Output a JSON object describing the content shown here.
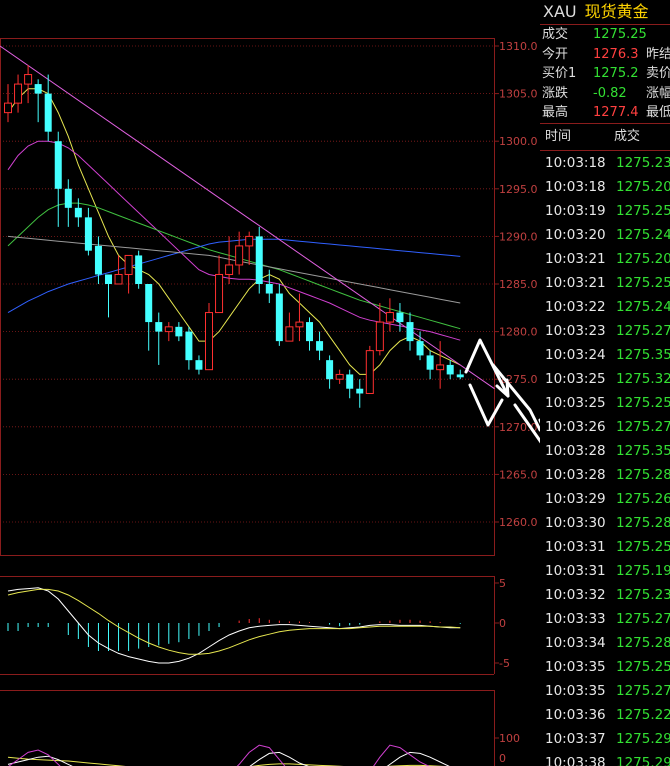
{
  "instrument": {
    "symbol": "XAU",
    "name": "现货黄金"
  },
  "quote": [
    {
      "label": "成交",
      "value": "1275.25",
      "color": "#33e033",
      "label2": ""
    },
    {
      "label": "今开",
      "value": "1276.3",
      "color": "#ff4040",
      "label2": "昨结"
    },
    {
      "label": "买价1",
      "value": "1275.2",
      "color": "#33e033",
      "label2": "卖价"
    },
    {
      "label": "涨跌",
      "value": "-0.82",
      "color": "#33e033",
      "label2": "涨幅"
    },
    {
      "label": "最高",
      "value": "1277.4",
      "color": "#ff4040",
      "label2": "最低"
    }
  ],
  "ticks_header": {
    "time": "时间",
    "price": "成交"
  },
  "ticks": [
    {
      "time": "10:03:18",
      "price": "1275.23",
      "color": "#33e033"
    },
    {
      "time": "10:03:18",
      "price": "1275.20",
      "color": "#33e033"
    },
    {
      "time": "10:03:19",
      "price": "1275.25",
      "color": "#33e033"
    },
    {
      "time": "10:03:20",
      "price": "1275.24",
      "color": "#33e033"
    },
    {
      "time": "10:03:21",
      "price": "1275.20",
      "color": "#33e033"
    },
    {
      "time": "10:03:21",
      "price": "1275.25",
      "color": "#33e033"
    },
    {
      "time": "10:03:22",
      "price": "1275.24",
      "color": "#33e033"
    },
    {
      "time": "10:03:23",
      "price": "1275.27",
      "color": "#33e033"
    },
    {
      "time": "10:03:24",
      "price": "1275.35",
      "color": "#33e033"
    },
    {
      "time": "10:03:25",
      "price": "1275.32",
      "color": "#33e033"
    },
    {
      "time": "10:03:25",
      "price": "1275.25",
      "color": "#33e033"
    },
    {
      "time": "10:03:26",
      "price": "1275.27",
      "color": "#33e033"
    },
    {
      "time": "10:03:28",
      "price": "1275.35",
      "color": "#33e033"
    },
    {
      "time": "10:03:28",
      "price": "1275.28",
      "color": "#33e033"
    },
    {
      "time": "10:03:29",
      "price": "1275.26",
      "color": "#33e033"
    },
    {
      "time": "10:03:30",
      "price": "1275.28",
      "color": "#33e033"
    },
    {
      "time": "10:03:31",
      "price": "1275.25",
      "color": "#33e033"
    },
    {
      "time": "10:03:31",
      "price": "1275.19",
      "color": "#33e033"
    },
    {
      "time": "10:03:32",
      "price": "1275.23",
      "color": "#33e033"
    },
    {
      "time": "10:03:33",
      "price": "1275.27",
      "color": "#33e033"
    },
    {
      "time": "10:03:34",
      "price": "1275.28",
      "color": "#33e033"
    },
    {
      "time": "10:03:35",
      "price": "1275.25",
      "color": "#33e033"
    },
    {
      "time": "10:03:35",
      "price": "1275.27",
      "color": "#33e033"
    },
    {
      "time": "10:03:36",
      "price": "1275.22",
      "color": "#33e033"
    },
    {
      "time": "10:03:37",
      "price": "1275.29",
      "color": "#33e033"
    },
    {
      "time": "10:03:38",
      "price": "1275.29",
      "color": "#33e033"
    }
  ],
  "chart_data": {
    "type": "candlestick",
    "price_axis": {
      "ticks": [
        "1310.0",
        "1305.0",
        "1300.0",
        "1295.0",
        "1290.0",
        "1285.0",
        "1280.0",
        "1275.0",
        "1270.0",
        "1265.0",
        "1260.0"
      ],
      "range": [
        1256,
        1313
      ]
    },
    "candles": [
      {
        "o": 1303,
        "h": 1306,
        "c": 1304,
        "l": 1302
      },
      {
        "o": 1304,
        "h": 1307,
        "c": 1306,
        "l": 1303
      },
      {
        "o": 1306,
        "h": 1308,
        "c": 1307,
        "l": 1304
      },
      {
        "o": 1306,
        "h": 1306.5,
        "c": 1305,
        "l": 1302
      },
      {
        "o": 1305,
        "h": 1307,
        "c": 1301,
        "l": 1300
      },
      {
        "o": 1300,
        "h": 1301,
        "c": 1295,
        "l": 1291
      },
      {
        "o": 1295,
        "h": 1296,
        "c": 1293,
        "l": 1291
      },
      {
        "o": 1293,
        "h": 1294,
        "c": 1292,
        "l": 1291
      },
      {
        "o": 1292,
        "h": 1293,
        "c": 1288.5,
        "l": 1288
      },
      {
        "o": 1289,
        "h": 1290,
        "c": 1286,
        "l": 1285
      },
      {
        "o": 1286,
        "h": 1286,
        "c": 1285,
        "l": 1281.5
      },
      {
        "o": 1285,
        "h": 1288,
        "c": 1286,
        "l": 1285
      },
      {
        "o": 1286,
        "h": 1288,
        "c": 1288,
        "l": 1284
      },
      {
        "o": 1288,
        "h": 1288.5,
        "c": 1285,
        "l": 1284.5
      },
      {
        "o": 1285,
        "h": 1285,
        "c": 1281,
        "l": 1278
      },
      {
        "o": 1281,
        "h": 1282,
        "c": 1280,
        "l": 1276.5
      },
      {
        "o": 1280,
        "h": 1281,
        "c": 1280.5,
        "l": 1279
      },
      {
        "o": 1280.5,
        "h": 1281,
        "c": 1279.5,
        "l": 1279
      },
      {
        "o": 1280,
        "h": 1280.5,
        "c": 1277,
        "l": 1276
      },
      {
        "o": 1277,
        "h": 1277.5,
        "c": 1276,
        "l": 1275.5
      },
      {
        "o": 1276,
        "h": 1283,
        "c": 1282,
        "l": 1276
      },
      {
        "o": 1282,
        "h": 1288,
        "c": 1286,
        "l": 1282
      },
      {
        "o": 1286,
        "h": 1290,
        "c": 1287,
        "l": 1285
      },
      {
        "o": 1287,
        "h": 1290.5,
        "c": 1289,
        "l": 1286
      },
      {
        "o": 1289,
        "h": 1290.5,
        "c": 1290,
        "l": 1287
      },
      {
        "o": 1290,
        "h": 1291,
        "c": 1285,
        "l": 1284
      },
      {
        "o": 1285,
        "h": 1286.5,
        "c": 1284,
        "l": 1283
      },
      {
        "o": 1284,
        "h": 1285,
        "c": 1279,
        "l": 1278.5
      },
      {
        "o": 1279,
        "h": 1282,
        "c": 1280.5,
        "l": 1279
      },
      {
        "o": 1280.5,
        "h": 1284,
        "c": 1281,
        "l": 1279
      },
      {
        "o": 1281,
        "h": 1281.5,
        "c": 1279,
        "l": 1278
      },
      {
        "o": 1279,
        "h": 1280,
        "c": 1278,
        "l": 1277
      },
      {
        "o": 1277,
        "h": 1277.5,
        "c": 1275,
        "l": 1274
      },
      {
        "o": 1275,
        "h": 1276,
        "c": 1275.5,
        "l": 1274.5
      },
      {
        "o": 1275.5,
        "h": 1276,
        "c": 1274,
        "l": 1273
      },
      {
        "o": 1274,
        "h": 1275,
        "c": 1273.5,
        "l": 1272
      },
      {
        "o": 1273.5,
        "h": 1278.5,
        "c": 1278,
        "l": 1273.5
      },
      {
        "o": 1278,
        "h": 1283,
        "c": 1281,
        "l": 1277.5
      },
      {
        "o": 1281,
        "h": 1283.5,
        "c": 1282,
        "l": 1280
      },
      {
        "o": 1282,
        "h": 1283,
        "c": 1281,
        "l": 1280
      },
      {
        "o": 1281,
        "h": 1282,
        "c": 1279,
        "l": 1278
      },
      {
        "o": 1279,
        "h": 1280,
        "c": 1277.5,
        "l": 1277
      },
      {
        "o": 1277.5,
        "h": 1278,
        "c": 1276,
        "l": 1275
      },
      {
        "o": 1276,
        "h": 1279,
        "c": 1276.5,
        "l": 1274
      },
      {
        "o": 1276.5,
        "h": 1277,
        "c": 1275.5,
        "l": 1275
      },
      {
        "o": 1275.5,
        "h": 1276,
        "c": 1275.2,
        "l": 1275
      }
    ],
    "ma": [
      {
        "name": "MA-yellow",
        "color": "#e6e650",
        "values": [
          1303,
          1304.5,
          1305.5,
          1305.5,
          1305,
          1303,
          1300.5,
          1297.5,
          1295,
          1292.5,
          1290,
          1288,
          1287,
          1286.5,
          1286,
          1285,
          1283.5,
          1282,
          1280.5,
          1279,
          1279,
          1280,
          1281.5,
          1283,
          1284.5,
          1285.5,
          1286,
          1285.5,
          1284,
          1283,
          1282,
          1281,
          1279.5,
          1278,
          1276.5,
          1275.5,
          1275.5,
          1276.5,
          1278,
          1279,
          1279.5,
          1279,
          1278,
          1277.5,
          1277,
          1276.5
        ]
      },
      {
        "name": "MA-magenta",
        "color": "#d040d0",
        "values": [
          1297,
          1298.5,
          1299.5,
          1300,
          1300,
          1299.8,
          1299.3,
          1298.5,
          1297.5,
          1296.5,
          1295.5,
          1294.5,
          1293.5,
          1292.5,
          1291.5,
          1290.5,
          1289.5,
          1288.5,
          1287.5,
          1286.5,
          1286,
          1285.8,
          1285.6,
          1285.5,
          1285.5,
          1285.4,
          1285.2,
          1285,
          1284.6,
          1284.2,
          1283.8,
          1283.4,
          1283,
          1282.5,
          1282,
          1281.5,
          1281.2,
          1281,
          1280.8,
          1280.6,
          1280.4,
          1280.2,
          1280,
          1279.7,
          1279.4,
          1279.1
        ]
      },
      {
        "name": "MA-green",
        "color": "#40c040",
        "values": [
          1289,
          1290,
          1291,
          1292,
          1292.8,
          1293.3,
          1293.5,
          1293.5,
          1293.3,
          1293,
          1292.6,
          1292.2,
          1291.8,
          1291.4,
          1291,
          1290.6,
          1290.2,
          1289.8,
          1289.4,
          1289,
          1288.6,
          1288.3,
          1288,
          1287.7,
          1287.4,
          1287.1,
          1286.8,
          1286.5,
          1286.1,
          1285.7,
          1285.3,
          1284.9,
          1284.5,
          1284.1,
          1283.7,
          1283.3,
          1283,
          1282.7,
          1282.4,
          1282.1,
          1281.8,
          1281.5,
          1281.2,
          1280.9,
          1280.6,
          1280.3
        ]
      },
      {
        "name": "MA-blue",
        "color": "#3060ff",
        "values": [
          1282,
          1282.6,
          1283.2,
          1283.7,
          1284.2,
          1284.6,
          1285,
          1285.3,
          1285.6,
          1285.9,
          1286.2,
          1286.5,
          1286.8,
          1287.1,
          1287.4,
          1287.7,
          1288,
          1288.3,
          1288.6,
          1288.9,
          1289.2,
          1289.4,
          1289.5,
          1289.6,
          1289.7,
          1289.7,
          1289.7,
          1289.7,
          1289.6,
          1289.5,
          1289.4,
          1289.3,
          1289.2,
          1289.1,
          1289,
          1288.9,
          1288.8,
          1288.7,
          1288.6,
          1288.5,
          1288.4,
          1288.3,
          1288.2,
          1288.1,
          1288,
          1287.9
        ]
      },
      {
        "name": "MA-grey",
        "color": "#9a9a9a",
        "values": [
          1290,
          1289.9,
          1289.8,
          1289.7,
          1289.6,
          1289.5,
          1289.4,
          1289.3,
          1289.2,
          1289.1,
          1289,
          1288.9,
          1288.8,
          1288.7,
          1288.6,
          1288.5,
          1288.4,
          1288.3,
          1288.2,
          1288.1,
          1288,
          1287.8,
          1287.6,
          1287.4,
          1287.2,
          1287,
          1286.8,
          1286.6,
          1286.4,
          1286.2,
          1286,
          1285.8,
          1285.6,
          1285.4,
          1285.2,
          1285,
          1284.8,
          1284.6,
          1284.4,
          1284.2,
          1284,
          1283.8,
          1283.6,
          1283.4,
          1283.2,
          1283
        ]
      }
    ],
    "trendline": {
      "color": "#e060e0",
      "from": [
        0,
        1310
      ],
      "to": [
        50,
        1274
      ]
    },
    "macd_axis": {
      "ticks": [
        "5",
        "0",
        "-5"
      ]
    },
    "macd": {
      "hist": [
        -1,
        -1,
        -0.5,
        -0.5,
        -0.5,
        0,
        -1.5,
        -2,
        -3,
        -3.5,
        -3.5,
        -3.5,
        -3.5,
        -3.2,
        -3,
        -2.8,
        -2.6,
        -2.4,
        -2,
        -1.6,
        -1,
        -0.5,
        0,
        0.3,
        0.5,
        0.6,
        0.4,
        0.3,
        0.2,
        0.2,
        0.1,
        0,
        -0.2,
        -0.4,
        -0.3,
        -0.2,
        0,
        0.2,
        0.3,
        0.4,
        0.4,
        0.3,
        0.2,
        0.1,
        0,
        -0.1
      ],
      "dif": [
        4,
        4.2,
        4.3,
        4.4,
        4,
        3,
        1.5,
        0,
        -1.5,
        -2.5,
        -3.2,
        -3.8,
        -4.2,
        -4.5,
        -4.8,
        -5,
        -5,
        -4.8,
        -4.4,
        -3.8,
        -3,
        -2.2,
        -1.5,
        -1,
        -0.6,
        -0.4,
        -0.3,
        -0.2,
        -0.2,
        -0.3,
        -0.4,
        -0.5,
        -0.6,
        -0.7,
        -0.6,
        -0.5,
        -0.3,
        -0.2,
        -0.2,
        -0.3,
        -0.3,
        -0.3,
        -0.4,
        -0.5,
        -0.6,
        -0.6
      ],
      "dea": [
        3.5,
        3.8,
        4,
        4.2,
        4.2,
        4,
        3.5,
        2.8,
        2,
        1.2,
        0.3,
        -0.5,
        -1.2,
        -1.9,
        -2.5,
        -3,
        -3.4,
        -3.7,
        -3.9,
        -3.9,
        -3.8,
        -3.5,
        -3.1,
        -2.6,
        -2.1,
        -1.7,
        -1.4,
        -1.1,
        -0.9,
        -0.8,
        -0.7,
        -0.7,
        -0.7,
        -0.7,
        -0.7,
        -0.6,
        -0.5,
        -0.4,
        -0.4,
        -0.4,
        -0.4,
        -0.4,
        -0.4,
        -0.5,
        -0.5,
        -0.6
      ]
    },
    "osc_axis": {
      "ticks": [
        "100",
        "0"
      ]
    },
    "osc": {
      "k": [
        40,
        55,
        70,
        75,
        65,
        45,
        25,
        10,
        5,
        10,
        20,
        30,
        35,
        30,
        20,
        15,
        20,
        30,
        35,
        30,
        20,
        15,
        25,
        45,
        70,
        85,
        80,
        55,
        30,
        25,
        35,
        40,
        30,
        15,
        10,
        15,
        30,
        60,
        85,
        80,
        65,
        50,
        40,
        30,
        20,
        15
      ],
      "d": [
        45,
        50,
        55,
        60,
        62,
        55,
        45,
        35,
        25,
        20,
        20,
        22,
        26,
        28,
        27,
        25,
        23,
        24,
        27,
        28,
        26,
        23,
        22,
        28,
        40,
        55,
        68,
        70,
        60,
        48,
        40,
        38,
        36,
        30,
        24,
        20,
        20,
        30,
        45,
        60,
        70,
        68,
        60,
        50,
        40,
        32
      ],
      "j": [
        60,
        58,
        56,
        55,
        54,
        53,
        52,
        50,
        48,
        46,
        44,
        42,
        40,
        38,
        36,
        35,
        34,
        33,
        33,
        33,
        33,
        34,
        35,
        37,
        40,
        43,
        45,
        46,
        46,
        45,
        44,
        43,
        42,
        41,
        40,
        39,
        39,
        40,
        41,
        42,
        43,
        43,
        42,
        41,
        40,
        39
      ]
    }
  },
  "colors": {
    "up": "#ff3030",
    "down": "#44ffff",
    "grid": "#8a1c1c",
    "axis_text": "#c04040"
  }
}
